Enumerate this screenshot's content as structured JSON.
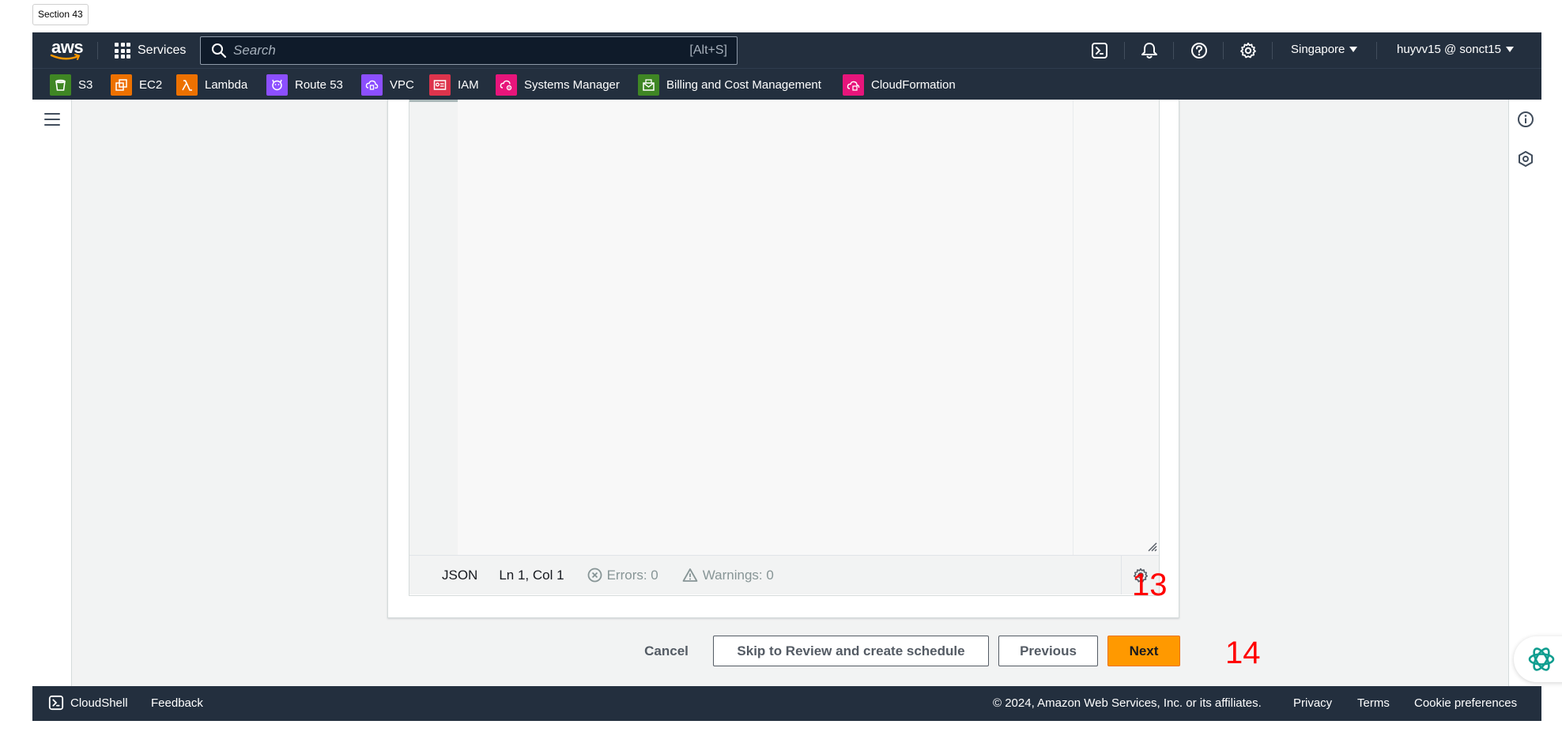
{
  "section_tag": "Section 43",
  "topnav": {
    "logo_text": "aws",
    "services_label": "Services",
    "search_placeholder": "Search",
    "search_shortcut": "[Alt+S]",
    "region": "Singapore",
    "account": "huyvv15 @ sonct15",
    "icons": [
      "cloudshell-icon",
      "bell-icon",
      "help-icon",
      "gear-icon"
    ]
  },
  "favorites": [
    {
      "label": "S3",
      "icon": "s3-icon",
      "color": "#3f8624"
    },
    {
      "label": "EC2",
      "icon": "ec2-icon",
      "color": "#ed7100"
    },
    {
      "label": "Lambda",
      "icon": "lambda-icon",
      "color": "#ed7100"
    },
    {
      "label": "Route 53",
      "icon": "route53-icon",
      "color": "#8c4fff"
    },
    {
      "label": "VPC",
      "icon": "vpc-icon",
      "color": "#8c4fff"
    },
    {
      "label": "IAM",
      "icon": "iam-icon",
      "color": "#dd344c"
    },
    {
      "label": "Systems Manager",
      "icon": "systems-manager-icon",
      "color": "#e7157b"
    },
    {
      "label": "Billing and Cost Management",
      "icon": "billing-icon",
      "color": "#3f8624"
    },
    {
      "label": "CloudFormation",
      "icon": "cloudformation-icon",
      "color": "#e7157b"
    }
  ],
  "editor": {
    "language": "JSON",
    "position": "Ln 1, Col 1",
    "errors": "Errors: 0",
    "warnings": "Warnings: 0"
  },
  "actions": {
    "cancel": "Cancel",
    "skip": "Skip to Review and create schedule",
    "previous": "Previous",
    "next": "Next"
  },
  "annotations": {
    "marker_13": "13",
    "marker_14": "14"
  },
  "footer": {
    "cloudshell": "CloudShell",
    "feedback": "Feedback",
    "copyright": "© 2024, Amazon Web Services, Inc. or its affiliates.",
    "privacy": "Privacy",
    "terms": "Terms",
    "cookies": "Cookie preferences"
  },
  "colors": {
    "nav_bg": "#232f3e",
    "primary": "#ff9900",
    "marker": "#ff0000"
  }
}
